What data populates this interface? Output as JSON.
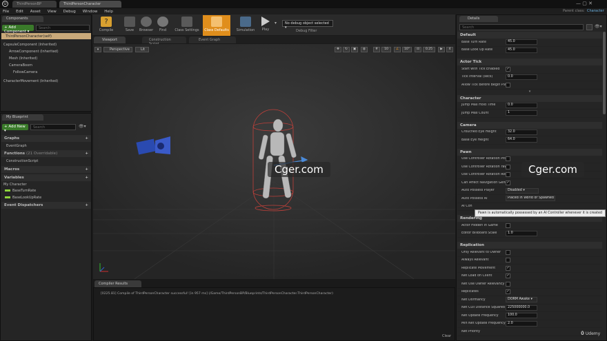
{
  "titlebar": {
    "tabs": [
      "ThirdPersonBP",
      "ThirdPersonCharacter"
    ],
    "right_parent": "Parent class:",
    "right_class": "Character"
  },
  "menu": [
    "File",
    "Edit",
    "Asset",
    "View",
    "Debug",
    "Window",
    "Help"
  ],
  "components": {
    "tab": "Components",
    "add": "+ Add Component ▾",
    "search_placeholder": "Search",
    "root": "ThirdPersonCharacter(self)",
    "items": [
      "CapsuleComponent (Inherited)",
      "ArrowComponent (Inherited)",
      "Mesh (Inherited)",
      "CameraBoom",
      "FollowCamera",
      "CharacterMovement (Inherited)"
    ]
  },
  "toolbar": {
    "buttons": [
      "Compile",
      "Save",
      "Browser",
      "Find",
      "Class Settings",
      "Class Defaults",
      "Simulation",
      "Play"
    ],
    "debug_value": "No debug object selected ▾",
    "debug_label": "Debug Filter"
  },
  "blueprint": {
    "tab": "My Blueprint",
    "add": "+ Add New ▾",
    "search_placeholder": "Search",
    "sections": {
      "graphs": "Graphs",
      "event_graph": "EventGraph",
      "functions": "Functions",
      "functions_count": "(21 Overridable)",
      "construction": "ConstructionScript",
      "macros": "Macros",
      "variables": "Variables",
      "my_character": "My Character",
      "var1": "BaseTurnRate",
      "var2": "BaseLookUpRate",
      "dispatchers": "Event Dispatchers"
    }
  },
  "editor_tabs": [
    "Viewport",
    "Construction Script",
    "Event Graph"
  ],
  "viewport": {
    "perspective": "Perspective",
    "lit": "Lit",
    "grid": "10",
    "angle": "10°",
    "scale": "0.25",
    "cam": "4"
  },
  "watermark": {
    "text1": "Cger.com",
    "text2": "Cger.com"
  },
  "compiler": {
    "tab": "Compiler Results",
    "message": "[0225.81] Compile of ThirdPersonCharacter successful! [in 957 ms] (/Game/ThirdPersonBP/Blueprints/ThirdPersonCharacter.ThirdPersonCharacter)",
    "clear": "Clear"
  },
  "details": {
    "tab": "Details",
    "search_placeholder": "Search",
    "default": {
      "title": "Default",
      "rows": [
        [
          "Base Turn Rate",
          "45.0"
        ],
        [
          "Base Look Up Rate",
          "45.0"
        ]
      ]
    },
    "actor_tick": {
      "title": "Actor Tick",
      "start": "Start with Tick Enabled",
      "interval": "Tick Interval (secs)",
      "interval_val": "0.0",
      "allow": "Allow Tick Before Begin Play"
    },
    "character": {
      "title": "Character",
      "rows": [
        [
          "Jump Max Hold Time",
          "0.0"
        ],
        [
          "Jump Max Count",
          "1"
        ]
      ]
    },
    "camera": {
      "title": "Camera",
      "rows": [
        [
          "Crouched Eye Height",
          "32.0"
        ],
        [
          "Base Eye Height",
          "64.0"
        ]
      ]
    },
    "pawn": {
      "title": "Pawn",
      "pitch": "Use Controller Rotation Pitch",
      "yaw": "Use Controller Rotation Yaw",
      "roll": "Use Controller Rotation Roll",
      "nav": "Can Affect Navigation Gener",
      "auto_player": "Auto Possess Player",
      "auto_player_val": "Disabled ▾",
      "auto_ai": "Auto Possess AI",
      "auto_ai_val": "Placed in World or Spawned ▾",
      "ai_controller": "AI Con"
    },
    "tooltip": "Pawn is automatically possessed by an AI Controller whenever it is created",
    "rendering": {
      "title": "Rendering",
      "hidden": "Actor Hidden in Game",
      "billboard": "Editor Billboard Scale",
      "billboard_val": "1.0"
    },
    "replication": {
      "title": "Replication",
      "rows": [
        "Only Relevant to Owner",
        "Always Relevant",
        "Replicate Movement",
        "Net Load on Client",
        "Net Use Owner Relevancy",
        "Replicates"
      ],
      "dormancy": "Net Dormancy",
      "dormancy_val": "DORM Awake ▾",
      "cull": "Net Cull Distance Squared",
      "cull_val": "225000000.0",
      "freq": "Net Update Frequency",
      "freq_val": "100.0",
      "minfreq": "Min Net Update Frequency",
      "minfreq_val": "2.0",
      "priority": "Net Priority"
    }
  },
  "udemy": "Udemy",
  "colors": {
    "accent_orange": "#e08e1c",
    "add_green": "#3a7a2a",
    "selection": "#4a5a6a"
  }
}
